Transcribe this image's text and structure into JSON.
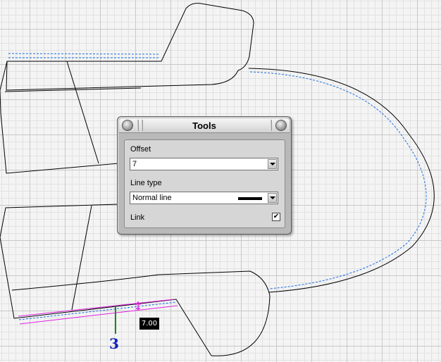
{
  "canvas": {
    "dimension_value": "7.00",
    "segment_marker": "3"
  },
  "tools_panel": {
    "title": "Tools",
    "offset_label": "Offset",
    "offset_value": "7",
    "line_type_label": "Line type",
    "line_type_value": "Normal line",
    "link_label": "Link",
    "link_checked": true,
    "link_check_glyph": "✔"
  },
  "icons": [
    "dropdown-arrow-icon",
    "window-button-icon",
    "checkmark-icon",
    "line-style-swatch"
  ],
  "colors": {
    "pattern_line": "#000000",
    "seam_allowance": "#1a6fe0",
    "selected_segment": "#e020e0",
    "marker_green": "#1a8a1a",
    "marker_label": "#1020c0"
  }
}
